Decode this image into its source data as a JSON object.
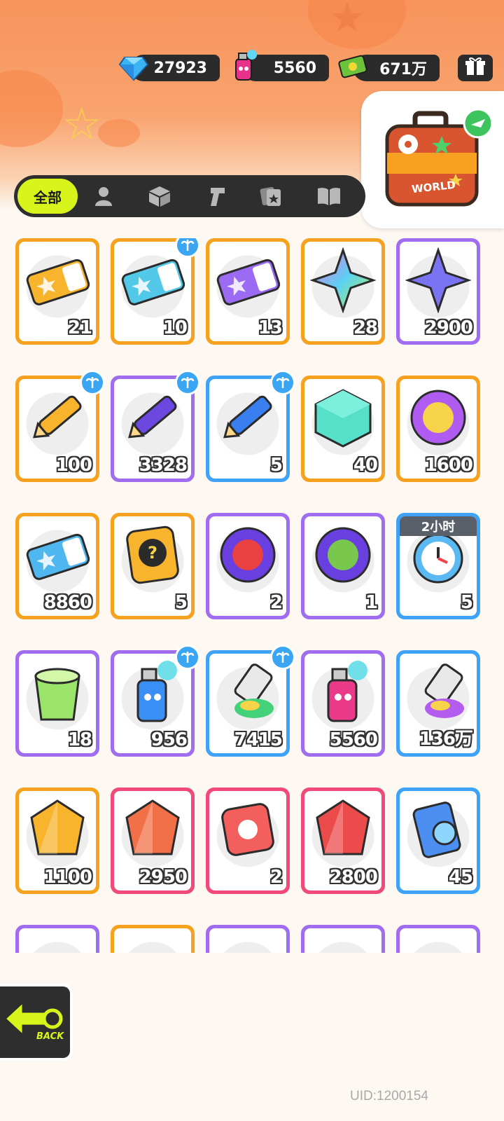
{
  "currencies": [
    {
      "name": "diamond",
      "icon": "diamond-icon",
      "value": "27923"
    },
    {
      "name": "spray-paint",
      "icon": "spray-can-icon",
      "value": "5560"
    },
    {
      "name": "cash",
      "icon": "cash-icon",
      "value": "671万"
    }
  ],
  "world_button": {
    "label": "WORLD"
  },
  "tabs": {
    "all_label": "全部",
    "icons": [
      "character-icon",
      "box-icon",
      "spray-gun-icon",
      "cards-icon",
      "book-icon"
    ]
  },
  "items": [
    {
      "icon": "gold-ticket-icon",
      "count": "21",
      "frame": "orange",
      "tag": false
    },
    {
      "icon": "wave-up-ticket-icon",
      "count": "10",
      "frame": "orange",
      "tag": true
    },
    {
      "icon": "purple-ticket-icon",
      "count": "13",
      "frame": "orange",
      "tag": false
    },
    {
      "icon": "rainbow-star-icon",
      "count": "28",
      "frame": "orange",
      "tag": false
    },
    {
      "icon": "purple-star-icon",
      "count": "2900",
      "frame": "purple",
      "tag": false
    },
    {
      "icon": "yellow-crayon-icon",
      "count": "100",
      "frame": "orange",
      "tag": true
    },
    {
      "icon": "purple-crayon-icon",
      "count": "3328",
      "frame": "purple",
      "tag": true
    },
    {
      "icon": "blue-crayon-icon",
      "count": "5",
      "frame": "blue",
      "tag": true
    },
    {
      "icon": "color-cube-icon",
      "count": "40",
      "frame": "orange",
      "tag": false
    },
    {
      "icon": "cool-badge-icon",
      "count": "1600",
      "frame": "orange",
      "tag": false
    },
    {
      "icon": "season-ticket-icon",
      "count": "8860",
      "frame": "orange",
      "tag": false
    },
    {
      "icon": "mystery-card-icon",
      "count": "5",
      "frame": "orange",
      "tag": false
    },
    {
      "icon": "fish-pet-orb-icon",
      "count": "2",
      "frame": "purple",
      "tag": false
    },
    {
      "icon": "plant-pet-orb-icon",
      "count": "1",
      "frame": "purple",
      "tag": false
    },
    {
      "icon": "alarm-clock-icon",
      "count": "5",
      "frame": "blue",
      "tag": false,
      "timer": "2小时"
    },
    {
      "icon": "green-cup-icon",
      "count": "18",
      "frame": "purple",
      "tag": false
    },
    {
      "icon": "blue-spray-can-icon",
      "count": "956",
      "frame": "purple",
      "tag": true
    },
    {
      "icon": "paint-tube-icon",
      "count": "7415",
      "frame": "blue",
      "tag": true
    },
    {
      "icon": "pink-spray-can-icon",
      "count": "5560",
      "frame": "purple",
      "tag": false
    },
    {
      "icon": "rainbow-paint-tube-icon",
      "count": "136万",
      "frame": "blue",
      "tag": false
    },
    {
      "icon": "gold-crystal-icon",
      "count": "1100",
      "frame": "orange",
      "tag": false
    },
    {
      "icon": "orange-crystal-icon",
      "count": "2950",
      "frame": "pink",
      "tag": false
    },
    {
      "icon": "red-dice-icon",
      "count": "2",
      "frame": "pink",
      "tag": false
    },
    {
      "icon": "red-gem-icon",
      "count": "2800",
      "frame": "pink",
      "tag": false
    },
    {
      "icon": "blue-cards-icon",
      "count": "45",
      "frame": "blue",
      "tag": false
    },
    {
      "icon": "partial-item-icon",
      "count": "",
      "frame": "purple",
      "tag": false
    },
    {
      "icon": "partial-item-icon",
      "count": "",
      "frame": "orange",
      "tag": false
    },
    {
      "icon": "partial-item-icon",
      "count": "",
      "frame": "purple",
      "tag": false
    },
    {
      "icon": "partial-item-icon",
      "count": "",
      "frame": "purple",
      "tag": false
    },
    {
      "icon": "partial-item-icon",
      "count": "",
      "frame": "purple",
      "tag": false
    }
  ],
  "back_button": {
    "label": "BACK"
  },
  "uid": "UID:1200154"
}
